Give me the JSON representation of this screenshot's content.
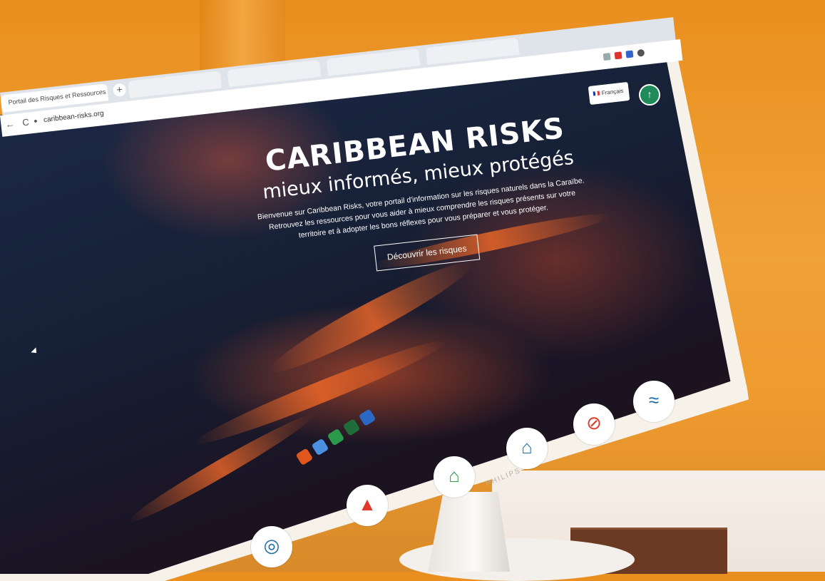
{
  "browser": {
    "active_tab_title": "Portail des Risques et Ressources",
    "tab_close": "×",
    "new_tab": "+",
    "url": "caribbean-risks.org",
    "back": "←",
    "forward": "→",
    "reload": "C"
  },
  "site": {
    "language_label": "Français",
    "user_initial": "↑",
    "title": "CARIBBEAN RISKS",
    "subtitle": "mieux informés, mieux protégés",
    "intro": "Bienvenue sur Caribbean Risks, votre portail d'information sur les risques naturels dans la Caraïbe. Retrouvez les ressources pour vous aider à mieux comprendre les risques présents sur votre territoire et à adopter les bons réflexes pour vous préparer et vous protéger.",
    "cta_label": "Découvrir les risques"
  },
  "monitor": {
    "brand": "PHILIPS"
  },
  "risk_icons": [
    "cyclone-icon",
    "volcano-icon",
    "landslide-icon",
    "house-icon",
    "no-entry-icon",
    "tsunami-icon"
  ],
  "colors": {
    "accent_green": "#1f8a5a",
    "lava": "#ff6e28",
    "wall": "#ee9a2e"
  }
}
